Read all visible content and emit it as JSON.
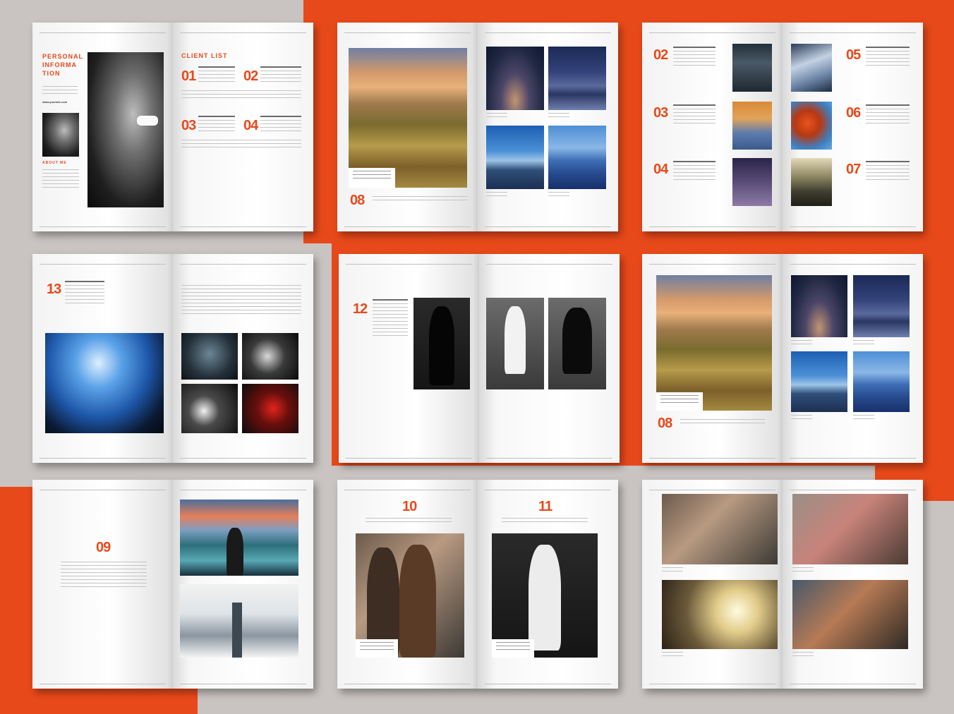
{
  "colors": {
    "accent": "#e8491a",
    "background": "#c9c4c1",
    "paper": "#ffffff"
  },
  "spread1": {
    "heading_lines": [
      "PERSONAL",
      "INFORMA",
      "TION"
    ],
    "website": "www.yoursite.com",
    "about_heading": "ABOUT ME",
    "client_list_heading": "CLIENT LIST",
    "numbers": [
      "01",
      "02",
      "03",
      "04"
    ]
  },
  "spread2": {
    "number": "08"
  },
  "spread3": {
    "numbers": [
      "02",
      "03",
      "04",
      "05",
      "06",
      "07"
    ]
  },
  "spread4": {
    "number": "13"
  },
  "spread5": {
    "number": "12"
  },
  "spread6": {
    "number": "08"
  },
  "spread7": {
    "number": "09"
  },
  "spread8": {
    "numbers": [
      "10",
      "11"
    ]
  }
}
